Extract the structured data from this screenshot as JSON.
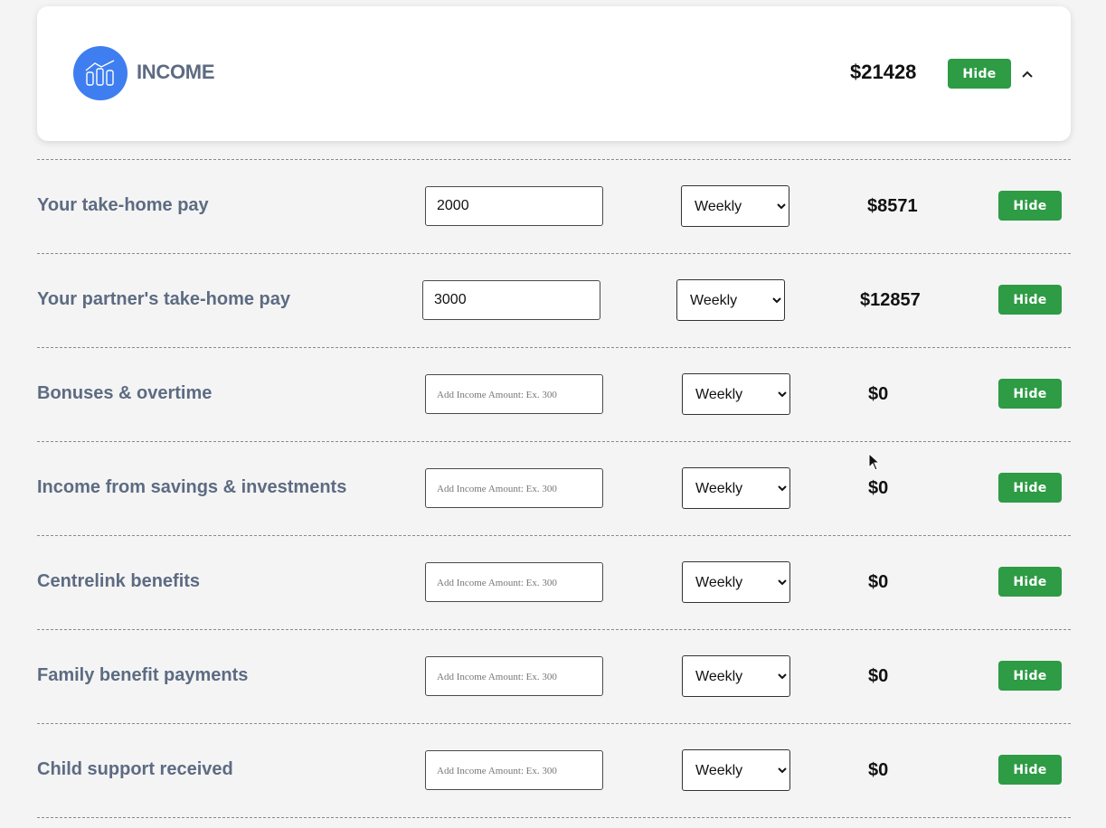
{
  "header": {
    "title": "INCOME",
    "total": "$21428",
    "hide_label": "Hide",
    "icon": "chart-icon",
    "collapse_icon": "chevron-up-icon"
  },
  "rows": [
    {
      "label": "Your take-home pay",
      "value": "2000",
      "placeholder": "",
      "frequency": "Weekly",
      "amount": "$8571",
      "hide_label": "Hide"
    },
    {
      "label": "Your partner's take-home pay",
      "value": "3000",
      "placeholder": "",
      "frequency": "Weekly",
      "amount": "$12857",
      "hide_label": "Hide"
    },
    {
      "label": "Bonuses & overtime",
      "value": "",
      "placeholder": "Add Income Amount: Ex. 300",
      "frequency": "Weekly",
      "amount": "$0",
      "hide_label": "Hide"
    },
    {
      "label": "Income from savings & investments",
      "value": "",
      "placeholder": "Add Income Amount: Ex. 300",
      "frequency": "Weekly",
      "amount": "$0",
      "hide_label": "Hide"
    },
    {
      "label": "Centrelink benefits",
      "value": "",
      "placeholder": "Add Income Amount: Ex. 300",
      "frequency": "Weekly",
      "amount": "$0",
      "hide_label": "Hide"
    },
    {
      "label": "Family benefit payments",
      "value": "",
      "placeholder": "Add Income Amount: Ex. 300",
      "frequency": "Weekly",
      "amount": "$0",
      "hide_label": "Hide"
    },
    {
      "label": "Child support received",
      "value": "",
      "placeholder": "Add Income Amount: Ex. 300",
      "frequency": "Weekly",
      "amount": "$0",
      "hide_label": "Hide"
    }
  ],
  "colors": {
    "accent_blue": "#3e7ef0",
    "hide_green": "#2e9b45",
    "label_slate": "#5d6b82",
    "background": "#f4f4f4"
  }
}
